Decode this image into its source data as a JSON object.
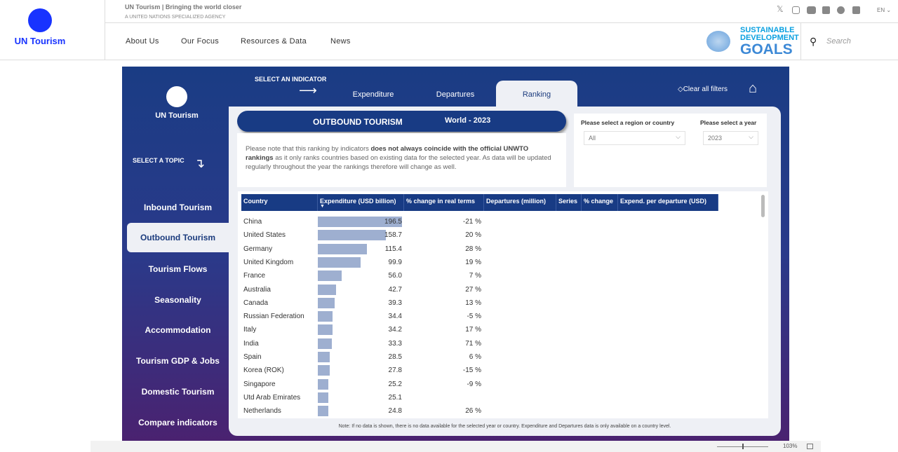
{
  "header": {
    "logo_text": "UN Tourism",
    "tagline": "UN Tourism | Bringing the world closer",
    "subtag": "A UNITED NATIONS SPECIALIZED AGENCY",
    "nav": [
      "About Us",
      "Our Focus",
      "Resources & Data",
      "News"
    ],
    "lang": "EN ⌄",
    "sdg_lines": [
      "SUSTAINABLE",
      "DEVELOPMENT",
      "GOALS"
    ],
    "search_placeholder": "Search",
    "social": [
      "x-icon",
      "instagram-icon",
      "youtube-icon",
      "flickr-icon",
      "facebook-icon",
      "linkedin-icon"
    ]
  },
  "report": {
    "logo_text": "UN Tourism",
    "select_topic": "SELECT A TOPIC",
    "select_indicator": "SELECT AN INDICATOR",
    "topics": [
      "Inbound Tourism",
      "Outbound Tourism",
      "Tourism Flows",
      "Seasonality",
      "Accommodation",
      "Tourism GDP & Jobs",
      "Domestic Tourism",
      "Compare indicators"
    ],
    "tabs": [
      "Expenditure",
      "Departures",
      "Ranking"
    ],
    "clear_filters": "Clear all filters",
    "banner_title": "OUTBOUND TOURISM",
    "banner_scope": "World - 2023",
    "note_pre": "Please note that this ranking by indicators ",
    "note_bold": "does not always coincide with the official UNWTO rankings",
    "note_post": " as it only ranks countries based on existing data for the selected year. As data will be updated regularly throughout the year the rankings therefore will change as well.",
    "region_label": "Please select a region or country",
    "region_value": "All",
    "year_label": "Please select a year",
    "year_value": "2023",
    "columns": [
      "Country",
      "Expenditure (USD billion)",
      "% change in real terms",
      "Departures (million)",
      "Series",
      "% change",
      "Expend. per departure (USD)"
    ],
    "rows": [
      {
        "country": "China",
        "exp": "196.5",
        "chg": "-21 %"
      },
      {
        "country": "United States",
        "exp": "158.7",
        "chg": "20 %"
      },
      {
        "country": "Germany",
        "exp": "115.4",
        "chg": "28 %"
      },
      {
        "country": "United Kingdom",
        "exp": "99.9",
        "chg": "19 %"
      },
      {
        "country": "France",
        "exp": "56.0",
        "chg": "7 %"
      },
      {
        "country": "Australia",
        "exp": "42.7",
        "chg": "27 %"
      },
      {
        "country": "Canada",
        "exp": "39.3",
        "chg": "13 %"
      },
      {
        "country": "Russian Federation",
        "exp": "34.4",
        "chg": "-5 %"
      },
      {
        "country": "Italy",
        "exp": "34.2",
        "chg": "17 %"
      },
      {
        "country": "India",
        "exp": "33.3",
        "chg": "71 %"
      },
      {
        "country": "Spain",
        "exp": "28.5",
        "chg": "6 %"
      },
      {
        "country": "Korea (ROK)",
        "exp": "27.8",
        "chg": "-15 %"
      },
      {
        "country": "Singapore",
        "exp": "25.2",
        "chg": "-9 %"
      },
      {
        "country": "Utd Arab Emirates",
        "exp": "25.1",
        "chg": ""
      },
      {
        "country": "Netherlands",
        "exp": "24.8",
        "chg": "26 %"
      }
    ],
    "footnote": "Note: If no data is shown, there is no data available for the selected year or country. Expenditure and Departures data is only available on a country level.",
    "zoom_level": "103%"
  }
}
